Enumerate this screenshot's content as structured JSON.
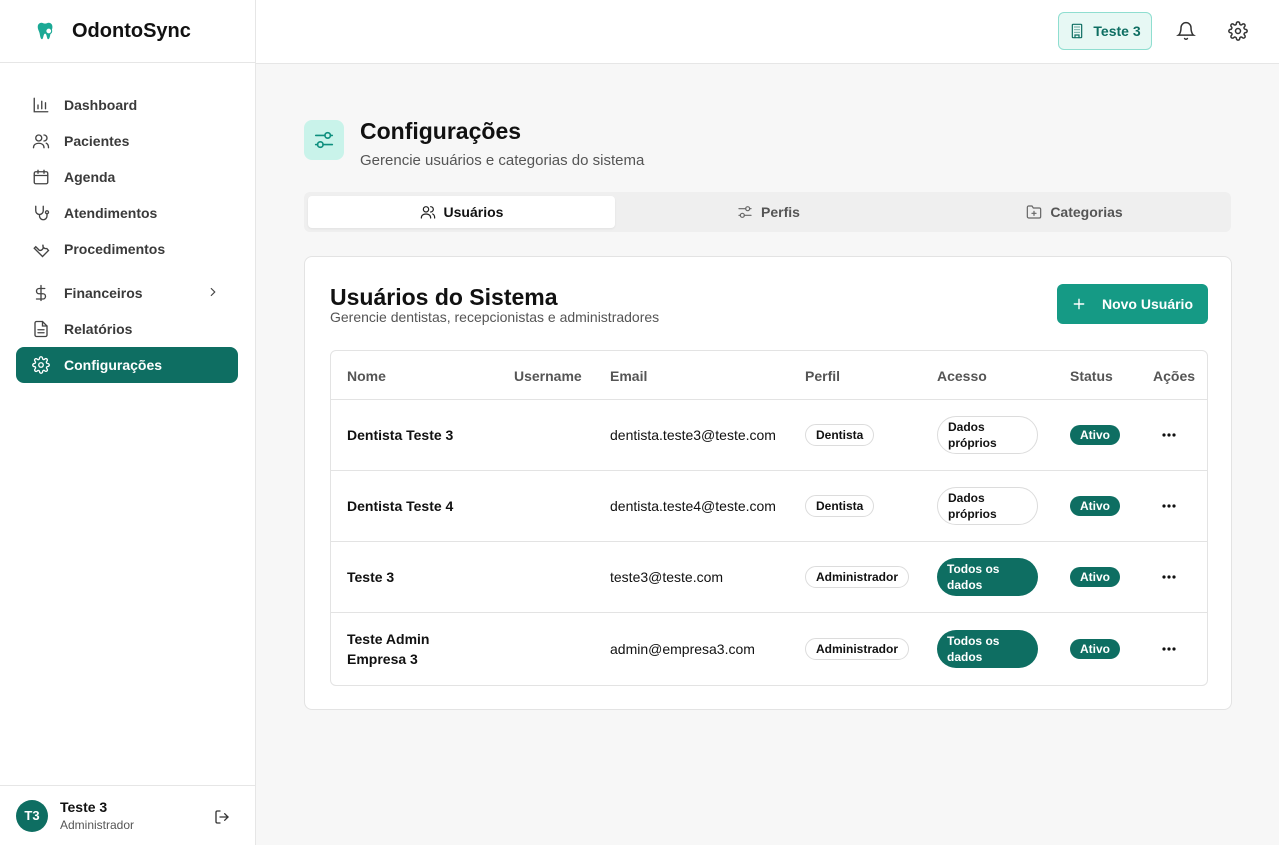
{
  "app": {
    "name": "OdontoSync"
  },
  "sidebar": {
    "items": [
      {
        "label": "Dashboard"
      },
      {
        "label": "Pacientes"
      },
      {
        "label": "Agenda"
      },
      {
        "label": "Atendimentos"
      },
      {
        "label": "Procedimentos"
      },
      {
        "label": "Financeiros"
      },
      {
        "label": "Relatórios"
      },
      {
        "label": "Configurações"
      }
    ],
    "active": "Configurações"
  },
  "user": {
    "initials": "T3",
    "name": "Teste 3",
    "role": "Administrador"
  },
  "header": {
    "tenant": "Teste 3"
  },
  "page": {
    "title": "Configurações",
    "subtitle": "Gerencie usuários e categorias do sistema"
  },
  "tabs": [
    {
      "label": "Usuários"
    },
    {
      "label": "Perfis"
    },
    {
      "label": "Categorias"
    }
  ],
  "users_card": {
    "title": "Usuários do Sistema",
    "subtitle": "Gerencie dentistas, recepcionistas e administradores",
    "new_button": "Novo Usuário",
    "columns": {
      "name": "Nome",
      "username": "Username",
      "email": "Email",
      "profile": "Perfil",
      "access": "Acesso",
      "status": "Status",
      "actions": "Ações"
    },
    "rows": [
      {
        "name": "Dentista Teste 3",
        "username": "",
        "email": "dentista.teste3@teste.com",
        "profile": "Dentista",
        "access": "Dados próprios",
        "status": "Ativo"
      },
      {
        "name": "Dentista Teste 4",
        "username": "",
        "email": "dentista.teste4@teste.com",
        "profile": "Dentista",
        "access": "Dados próprios",
        "status": "Ativo"
      },
      {
        "name": "Teste 3",
        "username": "",
        "email": "teste3@teste.com",
        "profile": "Administrador",
        "access": "Todos os dados",
        "status": "Ativo"
      },
      {
        "name": "Teste Admin Empresa 3",
        "username": "",
        "email": "admin@empresa3.com",
        "profile": "Administrador",
        "access": "Todos os dados",
        "status": "Ativo"
      }
    ]
  },
  "colors": {
    "primary": "#0e6e62",
    "button": "#159a85",
    "accent_light": "#c9f3ea"
  }
}
